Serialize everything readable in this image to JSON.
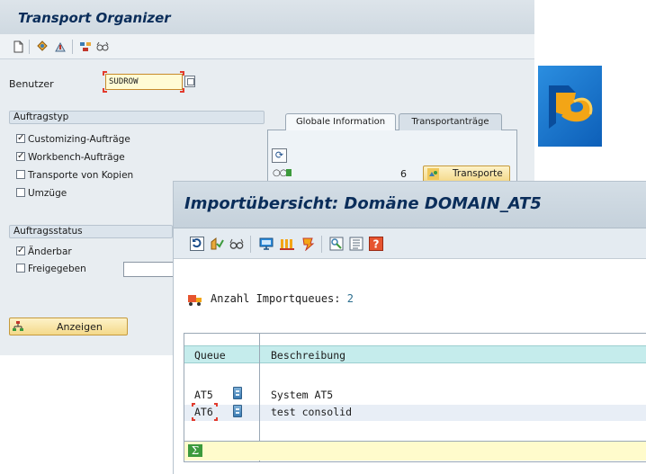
{
  "transport_organizer": {
    "title": "Transport Organizer",
    "user_label": "Benutzer",
    "user_value": "SUDROW",
    "request_type": {
      "heading": "Auftragstyp",
      "items": [
        {
          "label": "Customizing-Aufträge",
          "checked": true
        },
        {
          "label": "Workbench-Aufträge",
          "checked": true
        },
        {
          "label": "Transporte von Kopien",
          "checked": false
        },
        {
          "label": "Umzüge",
          "checked": false
        }
      ]
    },
    "request_status": {
      "heading": "Auftragsstatus",
      "items": [
        {
          "label": "Änderbar",
          "checked": true
        },
        {
          "label": "Freigegeben",
          "checked": false
        }
      ]
    },
    "display_button": "Anzeigen",
    "tabs": [
      {
        "label": "Globale Information",
        "active": true
      },
      {
        "label": "Transportanträge",
        "active": false
      }
    ],
    "transports_count": "6",
    "transports_button": "Transporte"
  },
  "import_overview": {
    "title": "Importübersicht: Domäne DOMAIN_AT5",
    "queue_count_label": "Anzahl Importqueues:",
    "queue_count": "2",
    "table": {
      "headers": [
        "Queue",
        "Beschreibung"
      ],
      "rows": [
        {
          "queue": "AT5",
          "description": "System AT5"
        },
        {
          "queue": "AT6",
          "description": "test consolid"
        }
      ]
    }
  },
  "colors": {
    "title_text": "#0a2d5a",
    "header_row": "#c5ecec",
    "sum_row": "#fffbcc",
    "button": "#f4d98a",
    "focus": "#e23b2e"
  }
}
